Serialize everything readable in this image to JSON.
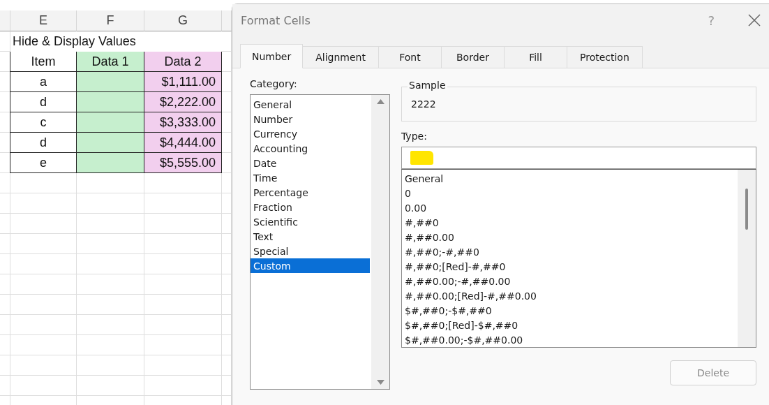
{
  "sheet": {
    "columns": [
      "E",
      "F",
      "G"
    ],
    "title": "Hide & Display Values",
    "headers": [
      "Item",
      "Data 1",
      "Data 2"
    ],
    "rows": [
      {
        "item": "a",
        "data_2": "$1,111.00"
      },
      {
        "item": "d",
        "data_2": "$2,222.00"
      },
      {
        "item": "c",
        "data_2": "$3,333.00"
      },
      {
        "item": "d",
        "data_2": "$4,444.00"
      },
      {
        "item": "e",
        "data_2": "$5,555.00"
      }
    ]
  },
  "dialog": {
    "title": "Format Cells",
    "help": "?",
    "tabs": [
      {
        "label": "Number",
        "selected": true
      },
      {
        "label": "Alignment",
        "selected": false
      },
      {
        "label": "Font",
        "selected": false
      },
      {
        "label": "Border",
        "selected": false
      },
      {
        "label": "Fill",
        "selected": false
      },
      {
        "label": "Protection",
        "selected": false
      }
    ],
    "category_label": "Category:",
    "categories": [
      {
        "label": "General",
        "selected": false
      },
      {
        "label": "Number",
        "selected": false
      },
      {
        "label": "Currency",
        "selected": false
      },
      {
        "label": "Accounting",
        "selected": false
      },
      {
        "label": "Date",
        "selected": false
      },
      {
        "label": "Time",
        "selected": false
      },
      {
        "label": "Percentage",
        "selected": false
      },
      {
        "label": "Fraction",
        "selected": false
      },
      {
        "label": "Scientific",
        "selected": false
      },
      {
        "label": "Text",
        "selected": false
      },
      {
        "label": "Special",
        "selected": false
      },
      {
        "label": "Custom",
        "selected": true
      }
    ],
    "sample_label": "Sample",
    "sample_value": "2222",
    "type_label": "Type:",
    "types": [
      "General",
      "0",
      "0.00",
      "#,##0",
      "#,##0.00",
      "#,##0;-#,##0",
      "#,##0;[Red]-#,##0",
      "#,##0.00;-#,##0.00",
      "#,##0.00;[Red]-#,##0.00",
      "$#,##0;-$#,##0",
      "$#,##0;[Red]-$#,##0",
      "$#,##0.00;-$#,##0.00"
    ],
    "delete_button": {
      "label": "Delete",
      "disabled": true
    }
  }
}
